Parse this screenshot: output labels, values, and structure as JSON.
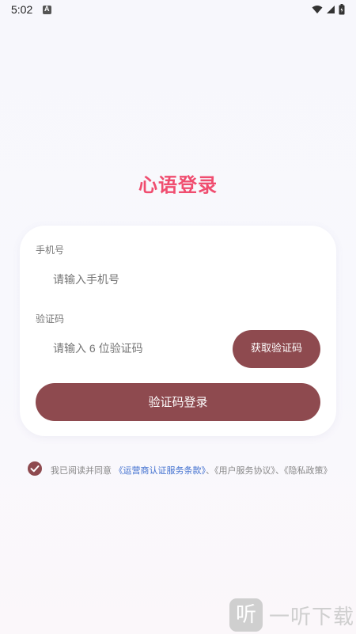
{
  "status_bar": {
    "time": "5:02",
    "icons": [
      "notification-a-icon",
      "wifi-icon",
      "signal-icon",
      "battery-icon"
    ]
  },
  "login": {
    "title": "心语登录",
    "phone_label": "手机号",
    "phone_placeholder": "请输入手机号",
    "code_label": "验证码",
    "code_placeholder": "请输入 6 位验证码",
    "get_code_button": "获取验证码",
    "submit_button": "验证码登录"
  },
  "agreement": {
    "checked": true,
    "prefix": "我已阅读并同意",
    "link1": "《运营商认证服务条款》",
    "sep1": "、",
    "link2": "《用户服务协议》",
    "sep2": "、",
    "link3": "《隐私政策》"
  },
  "watermark": {
    "logo_glyph": "听",
    "text": "一听下载"
  },
  "colors": {
    "title": "#f04d6f",
    "button": "#8e4a4f",
    "link": "#3f6fcf"
  }
}
